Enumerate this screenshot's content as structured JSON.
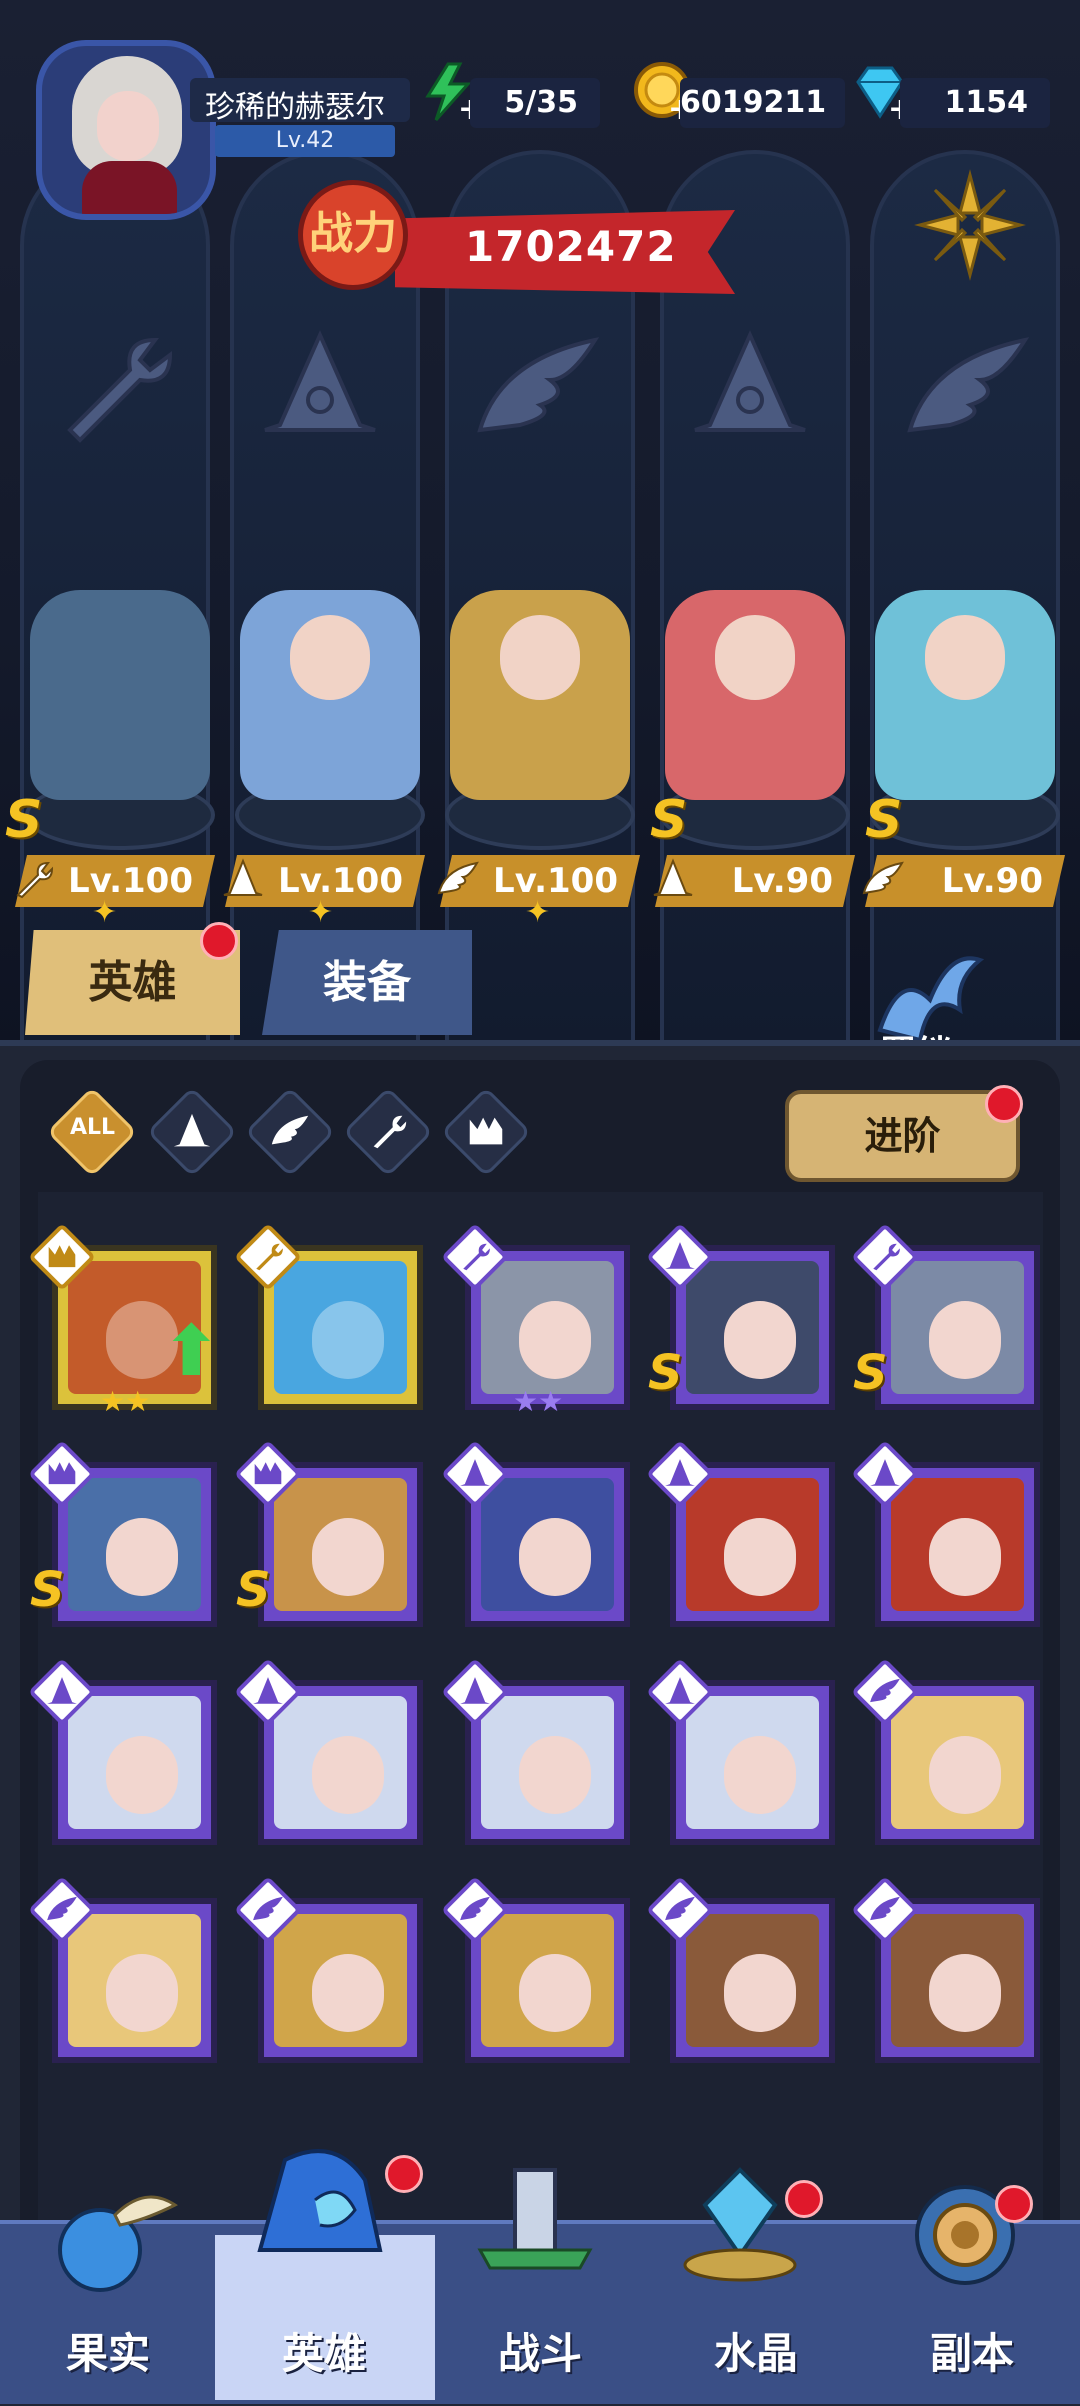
{
  "player": {
    "name": "珍稀的赫瑟尔",
    "level": "Lv.42"
  },
  "resources": {
    "energy": "5/35",
    "gold": "6019211",
    "gems": "1154"
  },
  "power": {
    "label": "战力",
    "value": "1702472"
  },
  "lineup": [
    {
      "level": "Lv.100",
      "rank": "S",
      "class": "wrench-icon",
      "stars": 1
    },
    {
      "level": "Lv.100",
      "rank": "",
      "class": "wizard-hat-icon",
      "stars": 1
    },
    {
      "level": "Lv.100",
      "rank": "",
      "class": "wing-icon",
      "stars": 1
    },
    {
      "level": "Lv.90",
      "rank": "S",
      "class": "wizard-hat-icon",
      "stars": 0
    },
    {
      "level": "Lv.90",
      "rank": "S",
      "class": "wing-icon",
      "stars": 0
    }
  ],
  "tabs": {
    "heroes": "英雄",
    "equipment": "装备"
  },
  "bond": {
    "label": "羁绊"
  },
  "filters": {
    "all": "ALL"
  },
  "advance_button": "进阶",
  "roster": [
    {
      "frame": "gold",
      "class": "beast-icon",
      "rank": "",
      "stars": "★★",
      "upgrade": true
    },
    {
      "frame": "gold",
      "class": "wrench-icon",
      "rank": "",
      "stars": "",
      "upgrade": false
    },
    {
      "frame": "purple",
      "class": "wrench-icon",
      "rank": "",
      "stars": "★★",
      "upgrade": false
    },
    {
      "frame": "purple",
      "class": "wizard-hat-icon",
      "rank": "S",
      "stars": "",
      "upgrade": false
    },
    {
      "frame": "purple",
      "class": "wrench-icon",
      "rank": "S",
      "stars": "",
      "upgrade": false
    },
    {
      "frame": "purple",
      "class": "beast-icon",
      "rank": "S",
      "stars": "",
      "upgrade": false
    },
    {
      "frame": "purple",
      "class": "beast-icon",
      "rank": "S",
      "stars": "",
      "upgrade": false
    },
    {
      "frame": "purple",
      "class": "wizard-hat-icon",
      "rank": "",
      "stars": "",
      "upgrade": false
    },
    {
      "frame": "purple",
      "class": "wizard-hat-icon",
      "rank": "",
      "stars": "",
      "upgrade": false
    },
    {
      "frame": "purple",
      "class": "wizard-hat-icon",
      "rank": "",
      "stars": "",
      "upgrade": false
    },
    {
      "frame": "purple",
      "class": "wizard-hat-icon",
      "rank": "",
      "stars": "",
      "upgrade": false
    },
    {
      "frame": "purple",
      "class": "wizard-hat-icon",
      "rank": "",
      "stars": "",
      "upgrade": false
    },
    {
      "frame": "purple",
      "class": "wizard-hat-icon",
      "rank": "",
      "stars": "",
      "upgrade": false
    },
    {
      "frame": "purple",
      "class": "wizard-hat-icon",
      "rank": "",
      "stars": "",
      "upgrade": false
    },
    {
      "frame": "purple",
      "class": "wing-icon",
      "rank": "",
      "stars": "",
      "upgrade": false
    },
    {
      "frame": "purple",
      "class": "wing-icon",
      "rank": "",
      "stars": "",
      "upgrade": false
    },
    {
      "frame": "purple",
      "class": "wing-icon",
      "rank": "",
      "stars": "",
      "upgrade": false
    },
    {
      "frame": "purple",
      "class": "wing-icon",
      "rank": "",
      "stars": "",
      "upgrade": false
    },
    {
      "frame": "purple",
      "class": "wing-icon",
      "rank": "",
      "stars": "",
      "upgrade": false
    },
    {
      "frame": "purple",
      "class": "wing-icon",
      "rank": "",
      "stars": "",
      "upgrade": false
    }
  ],
  "nav": [
    {
      "label": "果实",
      "icon": "fruit-icon",
      "selected": false,
      "dot": false
    },
    {
      "label": "英雄",
      "icon": "hero-hat-icon",
      "selected": true,
      "dot": true
    },
    {
      "label": "战斗",
      "icon": "battle-tower-icon",
      "selected": false,
      "dot": false
    },
    {
      "label": "水晶",
      "icon": "crystal-icon",
      "selected": false,
      "dot": true
    },
    {
      "label": "副本",
      "icon": "portal-icon",
      "selected": false,
      "dot": true
    }
  ],
  "colors": {
    "gold_frame": "#dcc23b",
    "purple_frame": "#6b49c8",
    "level_bar": "#c8902a",
    "power_banner": "#c4262b",
    "nav_bg": "#3a4f86",
    "red_dot": "#e0182b"
  }
}
